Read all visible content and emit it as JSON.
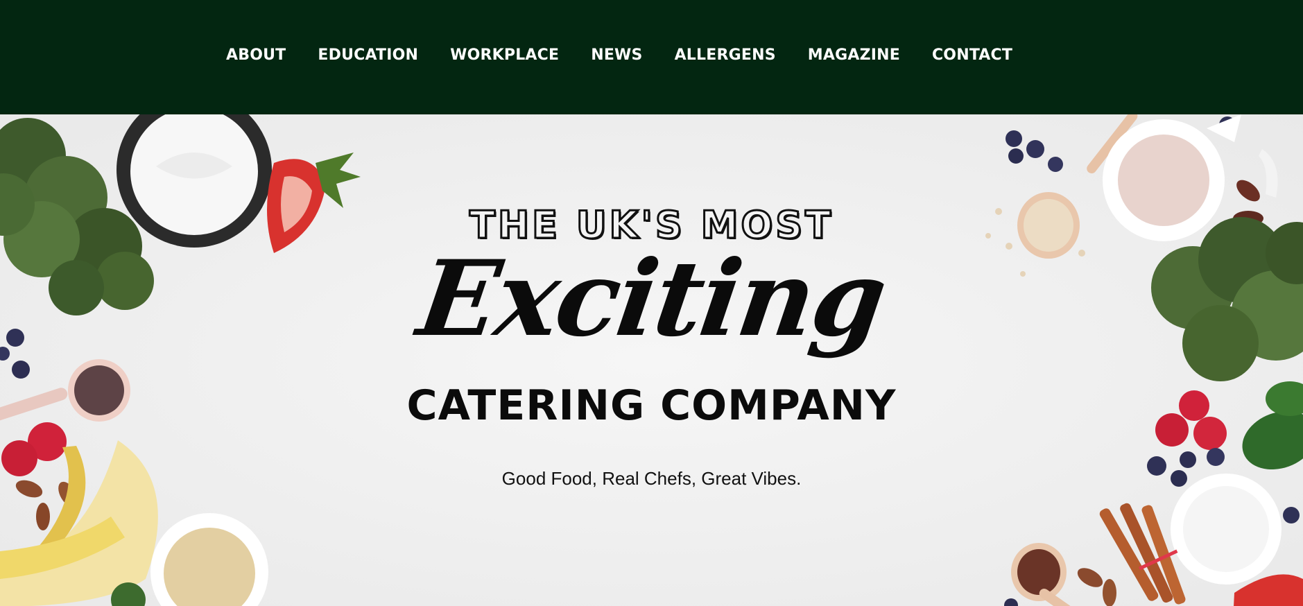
{
  "nav": {
    "items": [
      {
        "label": "ABOUT"
      },
      {
        "label": "EDUCATION"
      },
      {
        "label": "WORKPLACE"
      },
      {
        "label": "NEWS"
      },
      {
        "label": "ALLERGENS"
      },
      {
        "label": "MAGAZINE"
      },
      {
        "label": "CONTACT"
      }
    ]
  },
  "hero": {
    "line1": "THE UK'S MOST",
    "line2": "Exciting",
    "line3": "CATERING COMPANY",
    "tagline": "Good Food, Real Chefs, Great Vibes."
  },
  "colors": {
    "topbar": "#032611",
    "hero_bg": "#f1f1f1",
    "text": "#0b0b0b"
  },
  "icons": {
    "hero_decor": "food-ingredients-illustration"
  }
}
